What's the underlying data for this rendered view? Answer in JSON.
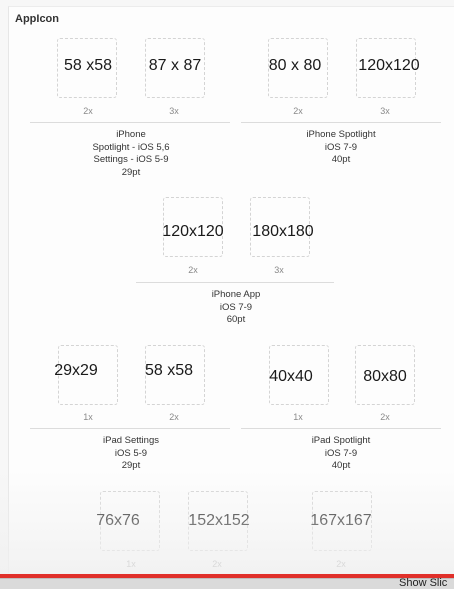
{
  "section_title": "AppIcon",
  "groups": [
    {
      "slots": [
        {
          "size": "58 x58",
          "scale": "2x"
        },
        {
          "size": "87 x 87",
          "scale": "3x"
        }
      ],
      "caption": [
        "iPhone",
        "Spotlight - iOS 5,6",
        "Settings - iOS 5-9",
        "29pt"
      ]
    },
    {
      "slots": [
        {
          "size": "80 x 80",
          "scale": "2x"
        },
        {
          "size": "120x120",
          "scale": "3x"
        }
      ],
      "caption": [
        "iPhone Spotlight",
        "iOS 7-9",
        "40pt"
      ]
    },
    {
      "slots": [
        {
          "size": "120x120",
          "scale": "2x"
        },
        {
          "size": "180x180",
          "scale": "3x"
        }
      ],
      "caption": [
        "iPhone App",
        "iOS 7-9",
        "60pt"
      ]
    },
    {
      "slots": [
        {
          "size": "29x29",
          "scale": "1x"
        },
        {
          "size": "58 x58",
          "scale": "2x"
        }
      ],
      "caption": [
        "iPad Settings",
        "iOS 5-9",
        "29pt"
      ]
    },
    {
      "slots": [
        {
          "size": "40x40",
          "scale": "1x"
        },
        {
          "size": "80x80",
          "scale": "2x"
        }
      ],
      "caption": [
        "iPad Spotlight",
        "iOS 7-9",
        "40pt"
      ]
    },
    {
      "slots": [
        {
          "size": "76x76",
          "scale": "1x"
        },
        {
          "size": "152x152",
          "scale": "2x"
        }
      ],
      "caption": []
    },
    {
      "slots": [
        {
          "size": "167x167",
          "scale": "2x"
        }
      ],
      "caption": []
    }
  ],
  "status_bar": {
    "show_slices": "Show Slic"
  },
  "colors": {
    "accent_bar": "#e0302a",
    "slot_border": "#d4d4d4"
  }
}
